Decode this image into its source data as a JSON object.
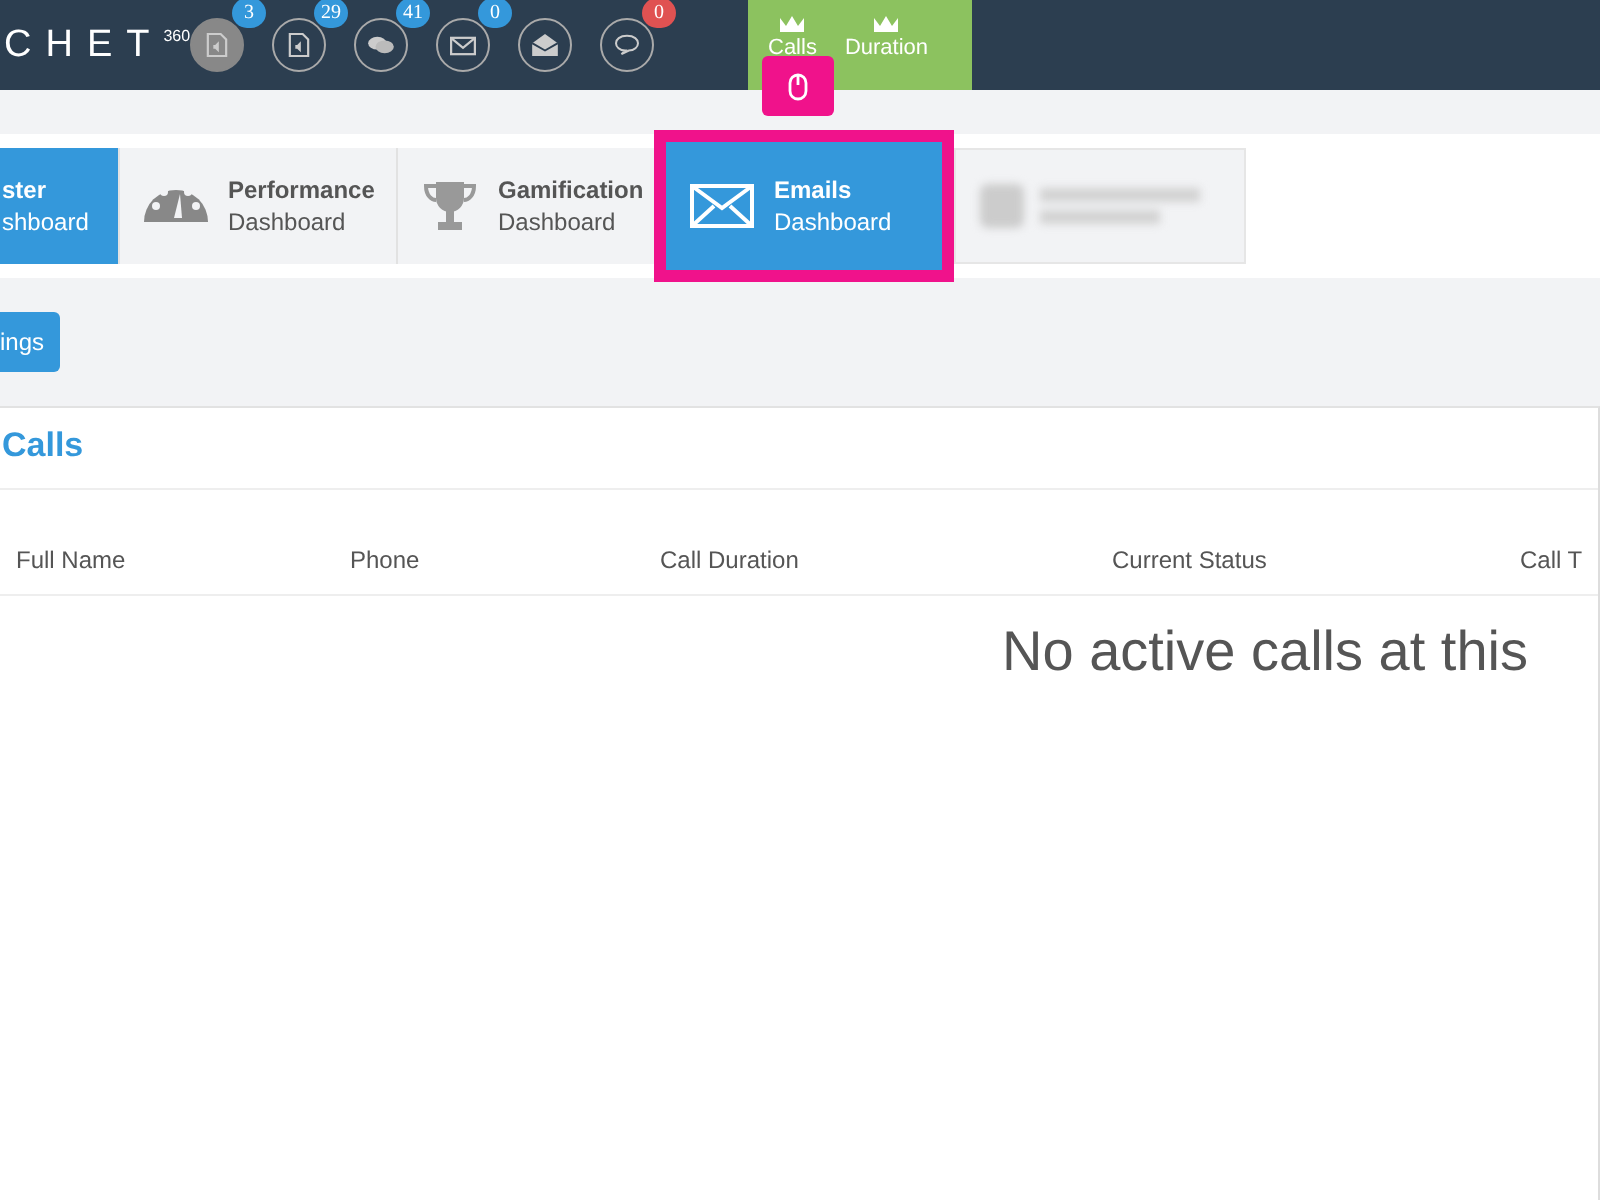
{
  "header": {
    "logo": "CHET",
    "logo_sup": "360",
    "notifications": [
      {
        "kind": "audio-file",
        "badge": "3",
        "color": "#3498db",
        "active": true
      },
      {
        "kind": "audio-file",
        "badge": "29",
        "color": "#3498db",
        "active": false
      },
      {
        "kind": "chat",
        "badge": "41",
        "color": "#3498db",
        "active": false
      },
      {
        "kind": "envelope",
        "badge": "0",
        "color": "#3498db",
        "active": false
      },
      {
        "kind": "open-envelope",
        "active": false
      },
      {
        "kind": "bubble",
        "badge": "0",
        "color": "#e05252",
        "active": false
      }
    ],
    "leaderboard": [
      {
        "label": "Calls"
      },
      {
        "label": "Duration"
      }
    ]
  },
  "tooltip": {
    "kind": "mouse"
  },
  "tabs": [
    {
      "kind": "cut",
      "title": "ster",
      "subtitle": "shboard",
      "active": true,
      "highlighted": false
    },
    {
      "kind": "gauge",
      "title": "Performance",
      "subtitle": "Dashboard",
      "active": false,
      "highlighted": false
    },
    {
      "kind": "trophy",
      "title": "Gamification",
      "subtitle": "Dashboard",
      "active": false,
      "highlighted": false
    },
    {
      "kind": "envelope",
      "title": "Emails",
      "subtitle": "Dashboard",
      "active": true,
      "highlighted": true
    },
    {
      "kind": "blurred",
      "active": false,
      "highlighted": false
    }
  ],
  "settings_button": "ings",
  "panel": {
    "title": "Calls",
    "columns": [
      "Full Name",
      "Phone",
      "Call Duration",
      "Current Status",
      "Call T"
    ],
    "empty": "No active calls at this"
  }
}
